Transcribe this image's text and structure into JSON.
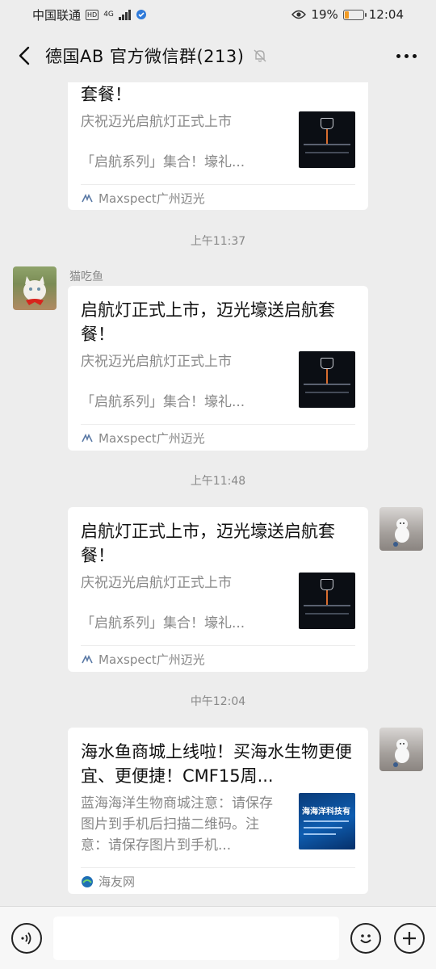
{
  "status_bar": {
    "carrier": "中国联通",
    "hd": "HD",
    "network": "4G",
    "battery_pct": "19%",
    "time": "12:04"
  },
  "header": {
    "title": "德国AB  官方微信群(213)"
  },
  "messages": [
    {
      "title": "套餐！",
      "desc1": "庆祝迈光启航灯正式上市",
      "desc2": "「启航系列」集合！壕礼...",
      "source": "Maxspect广州迈光"
    },
    {
      "time": "上午11:37",
      "sender": "猫吃鱼",
      "title": "启航灯正式上市，迈光壕送启航套餐！",
      "desc1": "庆祝迈光启航灯正式上市",
      "desc2": "「启航系列」集合！壕礼...",
      "source": "Maxspect广州迈光"
    },
    {
      "time": "上午11:48",
      "title": "启航灯正式上市，迈光壕送启航套餐！",
      "desc1": "庆祝迈光启航灯正式上市",
      "desc2": "「启航系列」集合！壕礼...",
      "source": "Maxspect广州迈光"
    },
    {
      "time": "中午12:04",
      "title": "海水鱼商城上线啦！买海水生物更便宜、更便捷！CMF15周...",
      "desc": "蓝海海洋生物商城注意：请保存图片到手机后扫描二维码。注意：请保存图片到手机...",
      "thumb_text": "海海洋科技有",
      "source": "海友网"
    }
  ]
}
